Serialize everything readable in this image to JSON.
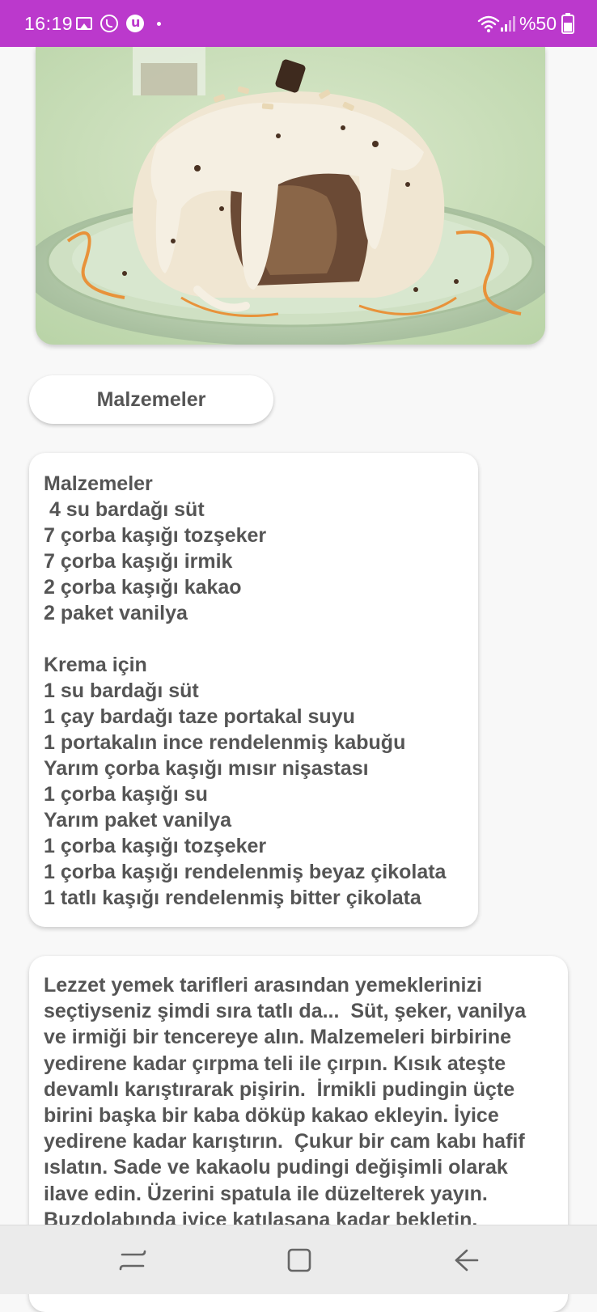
{
  "status_bar": {
    "time": "16:19",
    "battery_text": "%50",
    "left_icons": [
      "gallery-icon",
      "whatsapp-icon",
      "app-notification-icon",
      "more-dot-icon"
    ],
    "right_icons": [
      "wifi-icon",
      "signal-icon",
      "battery-icon"
    ],
    "background_color": "#bb39cc"
  },
  "recipe": {
    "image_alt_subject": "dessert-photo",
    "section_button_label": "Malzemeler",
    "ingredients_lines": [
      "Malzemeler",
      " 4 su bardağı süt",
      "7 çorba kaşığı tozşeker",
      "7 çorba kaşığı irmik",
      "2 çorba kaşığı kakao",
      "2 paket vanilya",
      "",
      "Krema için",
      "1 su bardağı süt",
      "1 çay bardağı taze portakal suyu",
      "1 portakalın ince rendelenmiş kabuğu",
      "Yarım çorba kaşığı mısır nişastası",
      "1 çorba kaşığı su",
      "Yarım paket vanilya",
      "1 çorba kaşığı tozşeker",
      "1 çorba kaşığı rendelenmiş beyaz çikolata",
      "1 tatlı kaşığı rendelenmiş bitter çikolata"
    ],
    "instructions_lines": [
      "Lezzet yemek tarifleri arasından yemeklerinizi",
      "seçtiyseniz şimdi sıra tatlı da...  Süt, şeker, vanilya",
      "ve irmiği bir tencereye alın. Malzemeleri birbirine",
      "yedirene kadar çırpma teli ile çırpın. Kısık ateşte",
      "devamlı karıştırarak pişirin.  İrmikli pudingin üçte",
      "birini başka bir kaba döküp kakao ekleyin. İyice",
      "yedirene kadar karıştırın.  Çukur bir cam kabı hafif",
      "ıslatın. Sade ve kakaolu pudingi değişimli olarak",
      "ilave edin. Üzerini spatula ile düzelterek yayın.",
      "Buzdolabında iyice katılaşana kadar bekletin."
    ]
  },
  "nav_bar": {
    "buttons": [
      "recent-apps-icon",
      "home-icon",
      "back-icon"
    ]
  }
}
